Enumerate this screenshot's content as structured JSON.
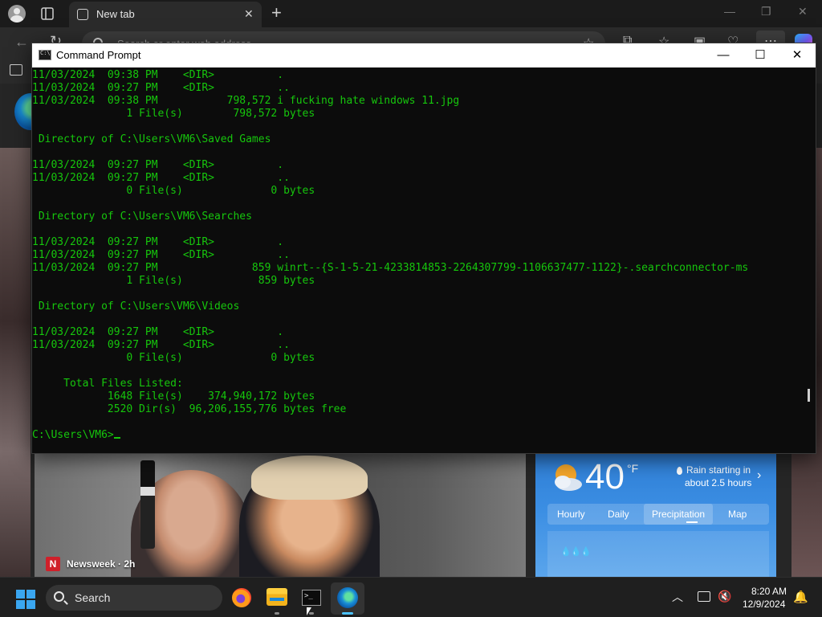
{
  "browser": {
    "tab_title": "New tab",
    "address_placeholder": "Search or enter web address"
  },
  "news": {
    "source_logo": "N",
    "source": "Newsweek · 2h"
  },
  "weather": {
    "temperature": "40",
    "unit": "°F",
    "alert_line1": "Rain starting in",
    "alert_line2": "about 2.5 hours",
    "tabs": [
      "Hourly",
      "Daily",
      "Precipitation",
      "Map"
    ],
    "active_tab": "Precipitation"
  },
  "cmd": {
    "title": "Command Prompt",
    "lines": [
      "11/03/2024  09:38 PM    <DIR>          .",
      "11/03/2024  09:27 PM    <DIR>          ..",
      "11/03/2024  09:38 PM           798,572 i fucking hate windows 11.jpg",
      "               1 File(s)        798,572 bytes",
      "",
      " Directory of C:\\Users\\VM6\\Saved Games",
      "",
      "11/03/2024  09:27 PM    <DIR>          .",
      "11/03/2024  09:27 PM    <DIR>          ..",
      "               0 File(s)              0 bytes",
      "",
      " Directory of C:\\Users\\VM6\\Searches",
      "",
      "11/03/2024  09:27 PM    <DIR>          .",
      "11/03/2024  09:27 PM    <DIR>          ..",
      "11/03/2024  09:27 PM               859 winrt--{S-1-5-21-4233814853-2264307799-1106637477-1122}-.searchconnector-ms",
      "               1 File(s)            859 bytes",
      "",
      " Directory of C:\\Users\\VM6\\Videos",
      "",
      "11/03/2024  09:27 PM    <DIR>          .",
      "11/03/2024  09:27 PM    <DIR>          ..",
      "               0 File(s)              0 bytes",
      "",
      "     Total Files Listed:",
      "            1648 File(s)    374,940,172 bytes",
      "            2520 Dir(s)  96,206,155,776 bytes free",
      ""
    ],
    "prompt": "C:\\Users\\VM6>"
  },
  "taskbar": {
    "search_label": "Search",
    "time": "8:20 AM",
    "date": "12/9/2024"
  }
}
